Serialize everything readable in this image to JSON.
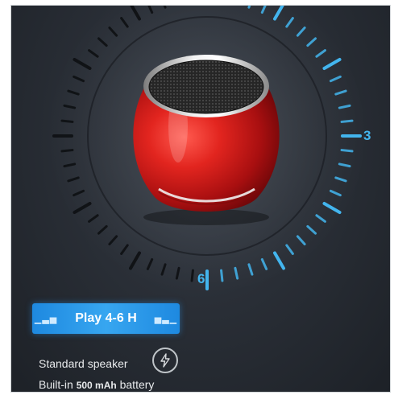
{
  "dial": {
    "label_right": "3",
    "label_bottom": "6",
    "accent_color": "#43b5ee"
  },
  "product": {
    "body_color": "#d31b1b",
    "trim_color": "#e6e6e6"
  },
  "play_badge": {
    "label": "Play",
    "duration": "4-6 H",
    "left_icon": "signal-bars-icon",
    "right_icon": "signal-bars-icon"
  },
  "specs": {
    "line1": "Standard speaker",
    "line1_icon": "lightning-bolt-icon",
    "line2_prefix": "Built-in",
    "line2_capacity": "500 mAh",
    "line2_suffix": "battery"
  }
}
